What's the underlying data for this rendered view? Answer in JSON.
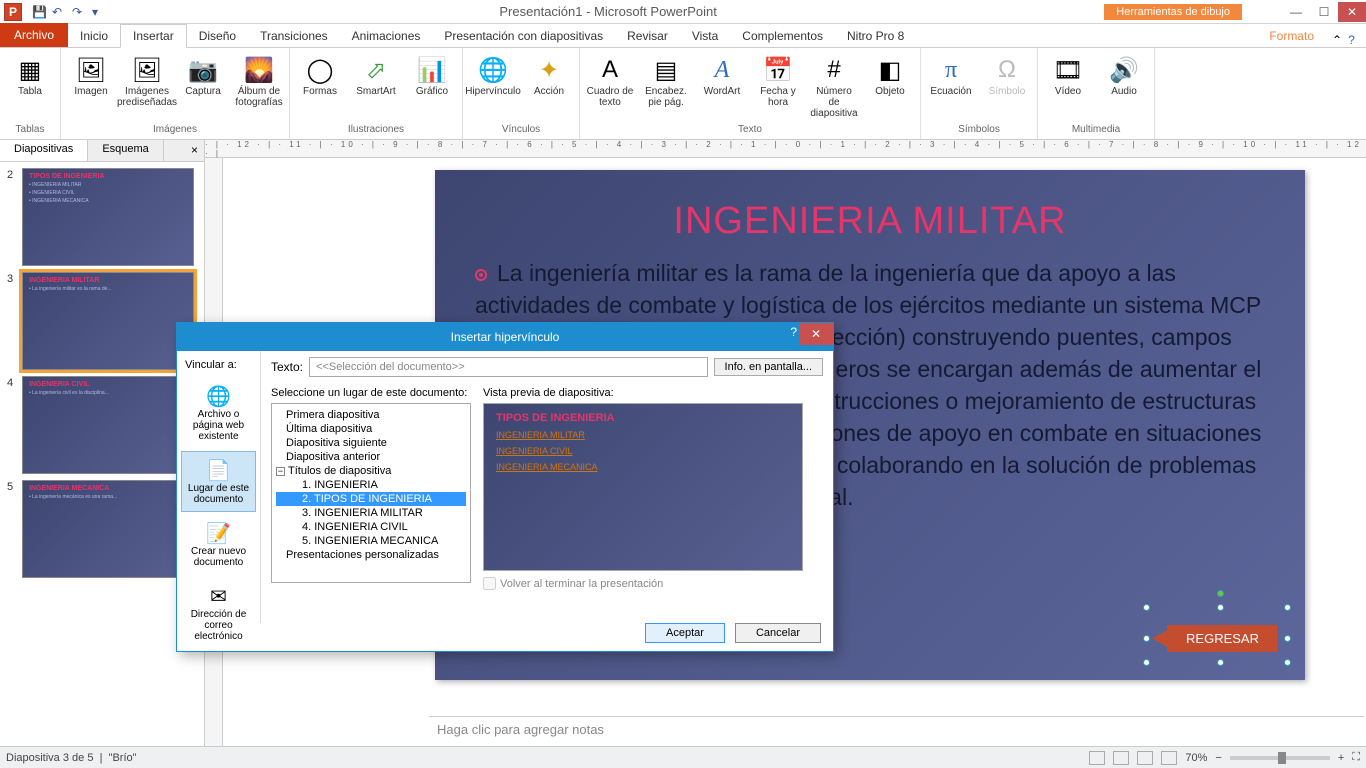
{
  "title": "Presentación1 - Microsoft PowerPoint",
  "contextual_tab": "Herramientas de dibujo",
  "tabs": {
    "file": "Archivo",
    "home": "Inicio",
    "insert": "Insertar",
    "design": "Diseño",
    "transitions": "Transiciones",
    "animations": "Animaciones",
    "slideshow": "Presentación con diapositivas",
    "review": "Revisar",
    "view": "Vista",
    "addins": "Complementos",
    "nitro": "Nitro Pro 8",
    "format": "Formato"
  },
  "ribbon": {
    "tabla": "Tabla",
    "imagen": "Imagen",
    "imagenes_pre": "Imágenes\nprediseñadas",
    "captura": "Captura",
    "album": "Álbum de\nfotografías",
    "formas": "Formas",
    "smartart": "SmartArt",
    "grafico": "Gráfico",
    "hipervinculo": "Hipervínculo",
    "accion": "Acción",
    "cuadro": "Cuadro\nde texto",
    "encabez": "Encabez.\npie pág.",
    "wordart": "WordArt",
    "fecha": "Fecha\ny hora",
    "numero": "Número de\ndiapositiva",
    "objeto": "Objeto",
    "ecuacion": "Ecuación",
    "simbolo": "Símbolo",
    "video": "Vídeo",
    "audio": "Audio",
    "g_tablas": "Tablas",
    "g_imagenes": "Imágenes",
    "g_ilustraciones": "Ilustraciones",
    "g_vinculos": "Vínculos",
    "g_texto": "Texto",
    "g_simbolos": "Símbolos",
    "g_multimedia": "Multimedia"
  },
  "panel": {
    "slides": "Diapositivas",
    "outline": "Esquema"
  },
  "thumbs": [
    {
      "n": "2",
      "title": "TIPOS DE INGENIERIA"
    },
    {
      "n": "3",
      "title": "INGENIERIA MILITAR"
    },
    {
      "n": "4",
      "title": "INGENIERIA CIVIL"
    },
    {
      "n": "5",
      "title": "INGENIERIA MECANICA"
    }
  ],
  "slide": {
    "title": "INGENIERIA MILITAR",
    "body": "La ingeniería militar es la rama de la ingeniería que da apoyo a las actividades de combate y logística de los ejércitos mediante un sistema MCP (Movilidad, Contra movilidad y Protección) construyendo puentes, campos minados, pasarelas, etc. Los ingenieros se encargan además de aumentar el poder defensivo por medio de construcciones o mejoramiento de estructuras de defensa. Además de sus situaciones de apoyo en combate en situaciones de guerra, actúa en épocas de paz colaborando en la solución de problemas de infraestructura de índole nacional.",
    "regresar": "REGRESAR"
  },
  "ruler": "· | · 12 · | · 11 · | · 10 · | · 9 · | · 8 · | · 7 · | · 6 · | · 5 · | · 4 · | · 3 · | · 2 · | · 1 · | · 0 · | · 1 · | · 2 · | · 3 · | · 4 · | · 5 · | · 6 · | · 7 · | · 8 · | · 9 · | · 10 · | · 11 · | · 12 · |",
  "notes_placeholder": "Haga clic para agregar notas",
  "status": {
    "left": "Diapositiva 3 de 5",
    "theme": "\"Brío\"",
    "zoom": "70%"
  },
  "dialog": {
    "title": "Insertar hipervínculo",
    "link_to": "Vincular a:",
    "text_lbl": "Texto:",
    "text_val": "<<Selección del documento>>",
    "info_btn": "Info. en pantalla...",
    "opts": {
      "file": "Archivo o página web existente",
      "place": "Lugar de este documento",
      "new": "Crear nuevo documento",
      "email": "Dirección de correo electrónico"
    },
    "select_lbl": "Seleccione un lugar de este documento:",
    "preview_lbl": "Vista previa de diapositiva:",
    "tree": {
      "first": "Primera diapositiva",
      "last": "Última diapositiva",
      "next": "Diapositiva siguiente",
      "prev": "Diapositiva anterior",
      "titles": "Títulos de diapositiva",
      "s1": "1. INGENIERIA",
      "s2": "2. TIPOS DE INGENIERIA",
      "s3": "3. INGENIERIA MILITAR",
      "s4": "4. INGENIERIA CIVIL",
      "s5": "5. INGENIERIA MECANICA",
      "custom": "Presentaciones personalizadas"
    },
    "prev_title": "TIPOS DE INGENIERIA",
    "prev_links": [
      "INGENIERIA MILITAR",
      "INGENIERIA CIVIL",
      "INGENIERIA MECANICA"
    ],
    "return_chk": "Volver al terminar la presentación",
    "ok": "Aceptar",
    "cancel": "Cancelar"
  }
}
